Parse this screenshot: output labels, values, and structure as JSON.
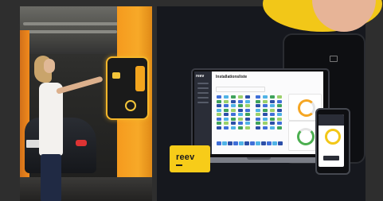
{
  "logo": {
    "text": "reev"
  },
  "laptop_ui": {
    "brand": "reev",
    "title": "Installationsliste"
  },
  "colors": {
    "brand_yellow": "#f7cc19",
    "orange_pillar": "#f59a1e",
    "panel_dark": "#16181e"
  }
}
